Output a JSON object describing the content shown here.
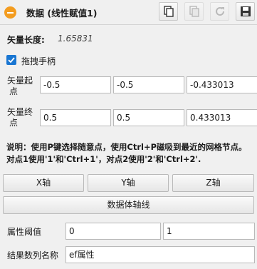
{
  "header": {
    "title": "数据 (线性赋值1)"
  },
  "toolbar": {
    "copy_icon": "copy-icon",
    "paste_icon": "paste-icon",
    "refresh_icon": "refresh-icon",
    "save_icon": "save-icon"
  },
  "vector_length": {
    "label": "矢量长度:",
    "value": "1.65831"
  },
  "drag_handle": {
    "label": "拖拽手柄",
    "checked": true
  },
  "start_point": {
    "label_line1": "矢量起",
    "label_line2": "点",
    "x": "-0.5",
    "y": "-0.5",
    "z": "-0.433013"
  },
  "end_point": {
    "label_line1": "矢量终",
    "label_line2": "点",
    "x": "0.5",
    "y": "0.5",
    "z": "0.433013"
  },
  "note": "说明：使用P键选择随意点，使用Ctrl+P磁吸到最近的网格节点。对点1使用'1'和'Ctrl+1'，对点2使用'2'和'Ctrl+2'.",
  "axis_buttons": {
    "x": "X轴",
    "y": "Y轴",
    "z": "Z轴"
  },
  "data_axis_button": "数据体轴线",
  "threshold": {
    "label": "属性阈值",
    "min": "0",
    "max": "1"
  },
  "result_name": {
    "label": "结果数列名称",
    "value": "ef属性"
  },
  "colors": {
    "accent": "#f39c1f",
    "checkbox": "#1976d2"
  }
}
